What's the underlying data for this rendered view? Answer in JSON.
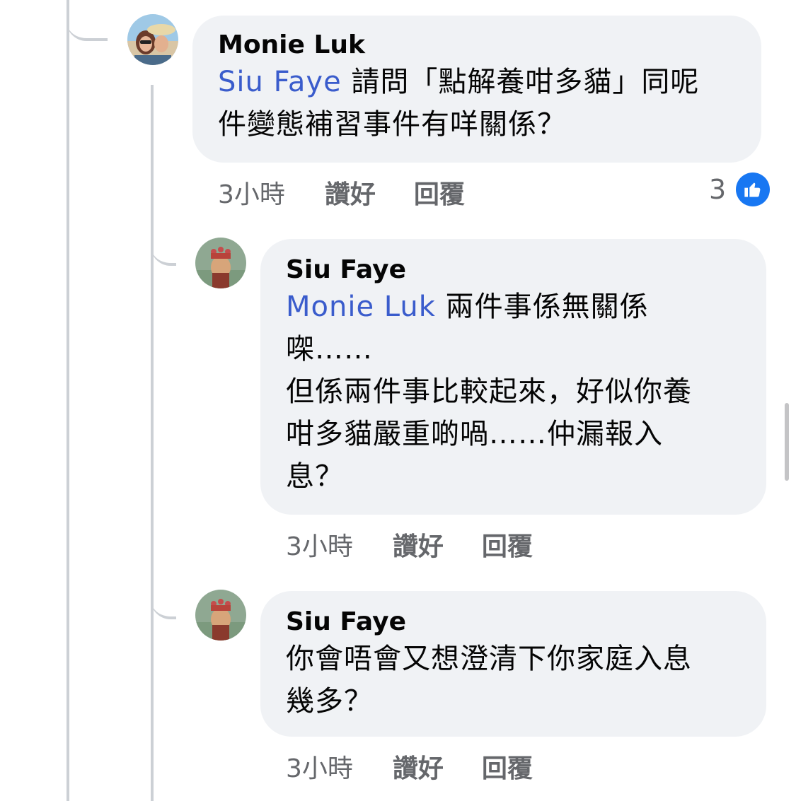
{
  "comments": [
    {
      "author": "Monie Luk",
      "mention": "Siu Faye",
      "text_line1": "請問「點解養咁多貓」同呢",
      "text_line2": "件變態補習事件有咩關係？",
      "time": "3小時",
      "like_label": "讚好",
      "reply_label": "回覆",
      "reaction_count": "3"
    },
    {
      "author": "Siu Faye",
      "mention": "Monie Luk",
      "text_line1": "兩件事係無關係",
      "text_line2": "㗎……",
      "text_line3": "但係兩件事比較起來，好似你養",
      "text_line4": "咁多貓嚴重啲喎……仲漏報入",
      "text_line5": "息？",
      "time": "3小時",
      "like_label": "讚好",
      "reply_label": "回覆"
    },
    {
      "author": "Siu Faye",
      "text_line1": "你會唔會又想澄清下你家庭入息",
      "text_line2": "幾多？",
      "time": "3小時",
      "like_label": "讚好",
      "reply_label": "回覆"
    }
  ],
  "colors": {
    "mention": "#3a5ccc",
    "like": "#1877f2",
    "bubble": "#f0f2f5",
    "muted": "#65676b"
  }
}
